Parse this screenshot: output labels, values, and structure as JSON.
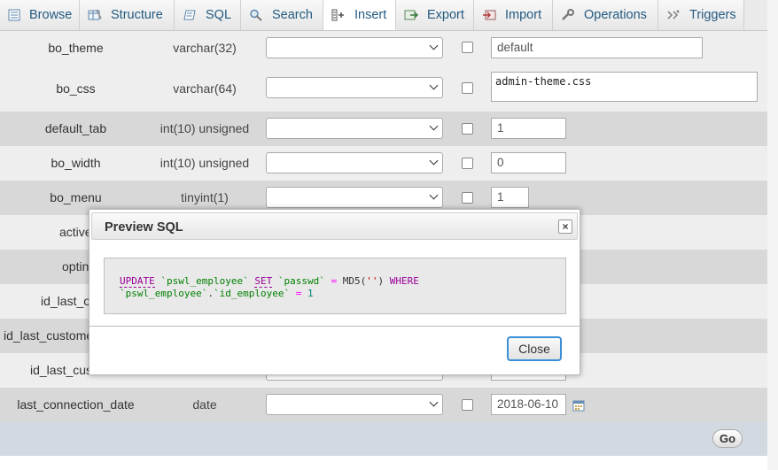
{
  "tabs": [
    {
      "label": "Browse",
      "icon": "browse-icon"
    },
    {
      "label": "Structure",
      "icon": "structure-icon"
    },
    {
      "label": "SQL",
      "icon": "sql-icon"
    },
    {
      "label": "Search",
      "icon": "search-icon"
    },
    {
      "label": "Insert",
      "icon": "insert-icon",
      "active": true
    },
    {
      "label": "Export",
      "icon": "export-icon"
    },
    {
      "label": "Import",
      "icon": "import-icon"
    },
    {
      "label": "Operations",
      "icon": "wrench-icon"
    },
    {
      "label": "Triggers",
      "icon": "triggers-icon"
    }
  ],
  "rows": [
    {
      "name": "bo_theme",
      "type": "varchar(32)",
      "value": "default"
    },
    {
      "name": "bo_css",
      "type": "varchar(64)",
      "value": "admin-theme.css"
    },
    {
      "name": "default_tab",
      "type": "int(10) unsigned",
      "value": "1"
    },
    {
      "name": "bo_width",
      "type": "int(10) unsigned",
      "value": "0"
    },
    {
      "name": "bo_menu",
      "type": "tinyint(1)",
      "value": "1"
    },
    {
      "name": "active",
      "type": "",
      "value": ""
    },
    {
      "name": "optin",
      "type": "",
      "value": ""
    },
    {
      "name": "id_last_o",
      "type": "",
      "value": ""
    },
    {
      "name": "id_last_customer",
      "type": "",
      "value": ""
    },
    {
      "name": "id_last_cus",
      "type": "",
      "value": ""
    },
    {
      "name": "last_connection_date",
      "type": "date",
      "value": "2018-06-10"
    }
  ],
  "go_label": "Go",
  "modal": {
    "title": "Preview SQL",
    "close_x": "×",
    "close_label": "Close",
    "sql": {
      "kw_update": "UPDATE",
      "tbl": "`pswl_employee`",
      "kw_set": "SET",
      "col": "`passwd`",
      "eq": "=",
      "fn": "MD5",
      "open": "(",
      "str": "''",
      "close": ")",
      "kw_where": "WHERE",
      "tbl2": "`pswl_employee`",
      "dot": ".",
      "col2": "`id_employee`",
      "eq2": "=",
      "num": "1"
    }
  },
  "colors": {
    "link": "#235a81",
    "keyword": "#990099",
    "focus": "#3b8fd6"
  }
}
